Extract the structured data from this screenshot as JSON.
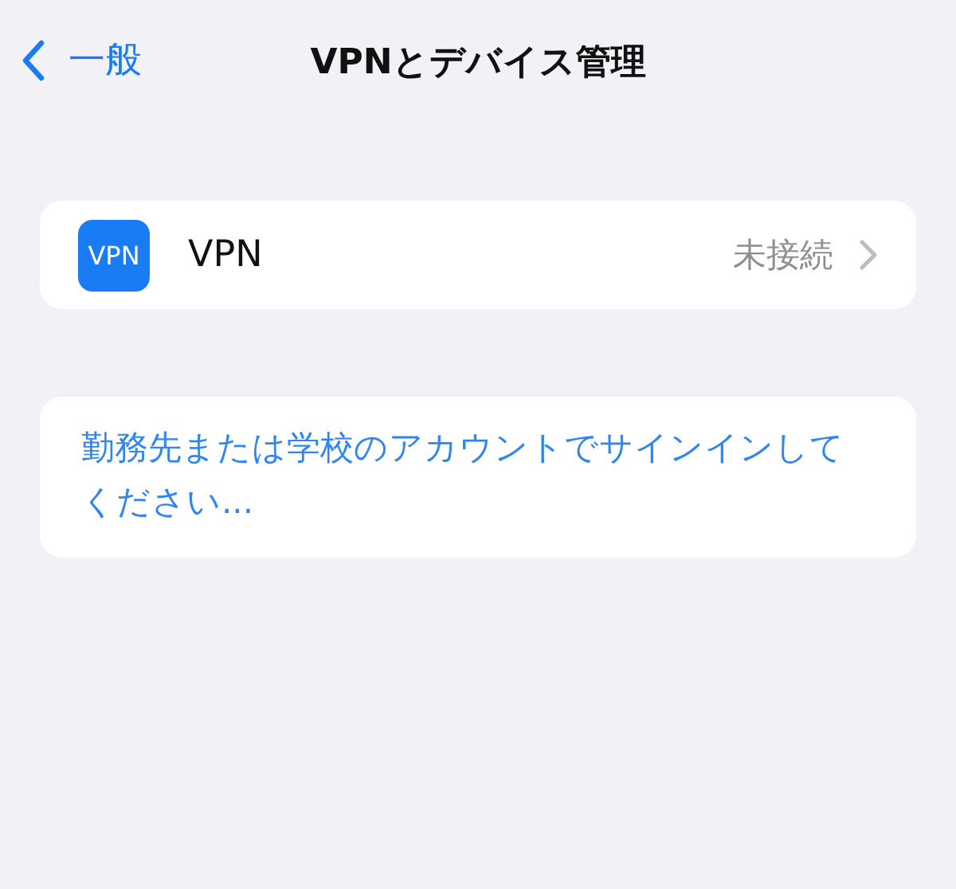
{
  "nav": {
    "back_label": "一般",
    "title": "VPNとデバイス管理"
  },
  "vpn_row": {
    "icon_text": "VPN",
    "label": "VPN",
    "status": "未接続"
  },
  "sign_in_link": "勤務先または学校のアカウントでサインインしてください..."
}
